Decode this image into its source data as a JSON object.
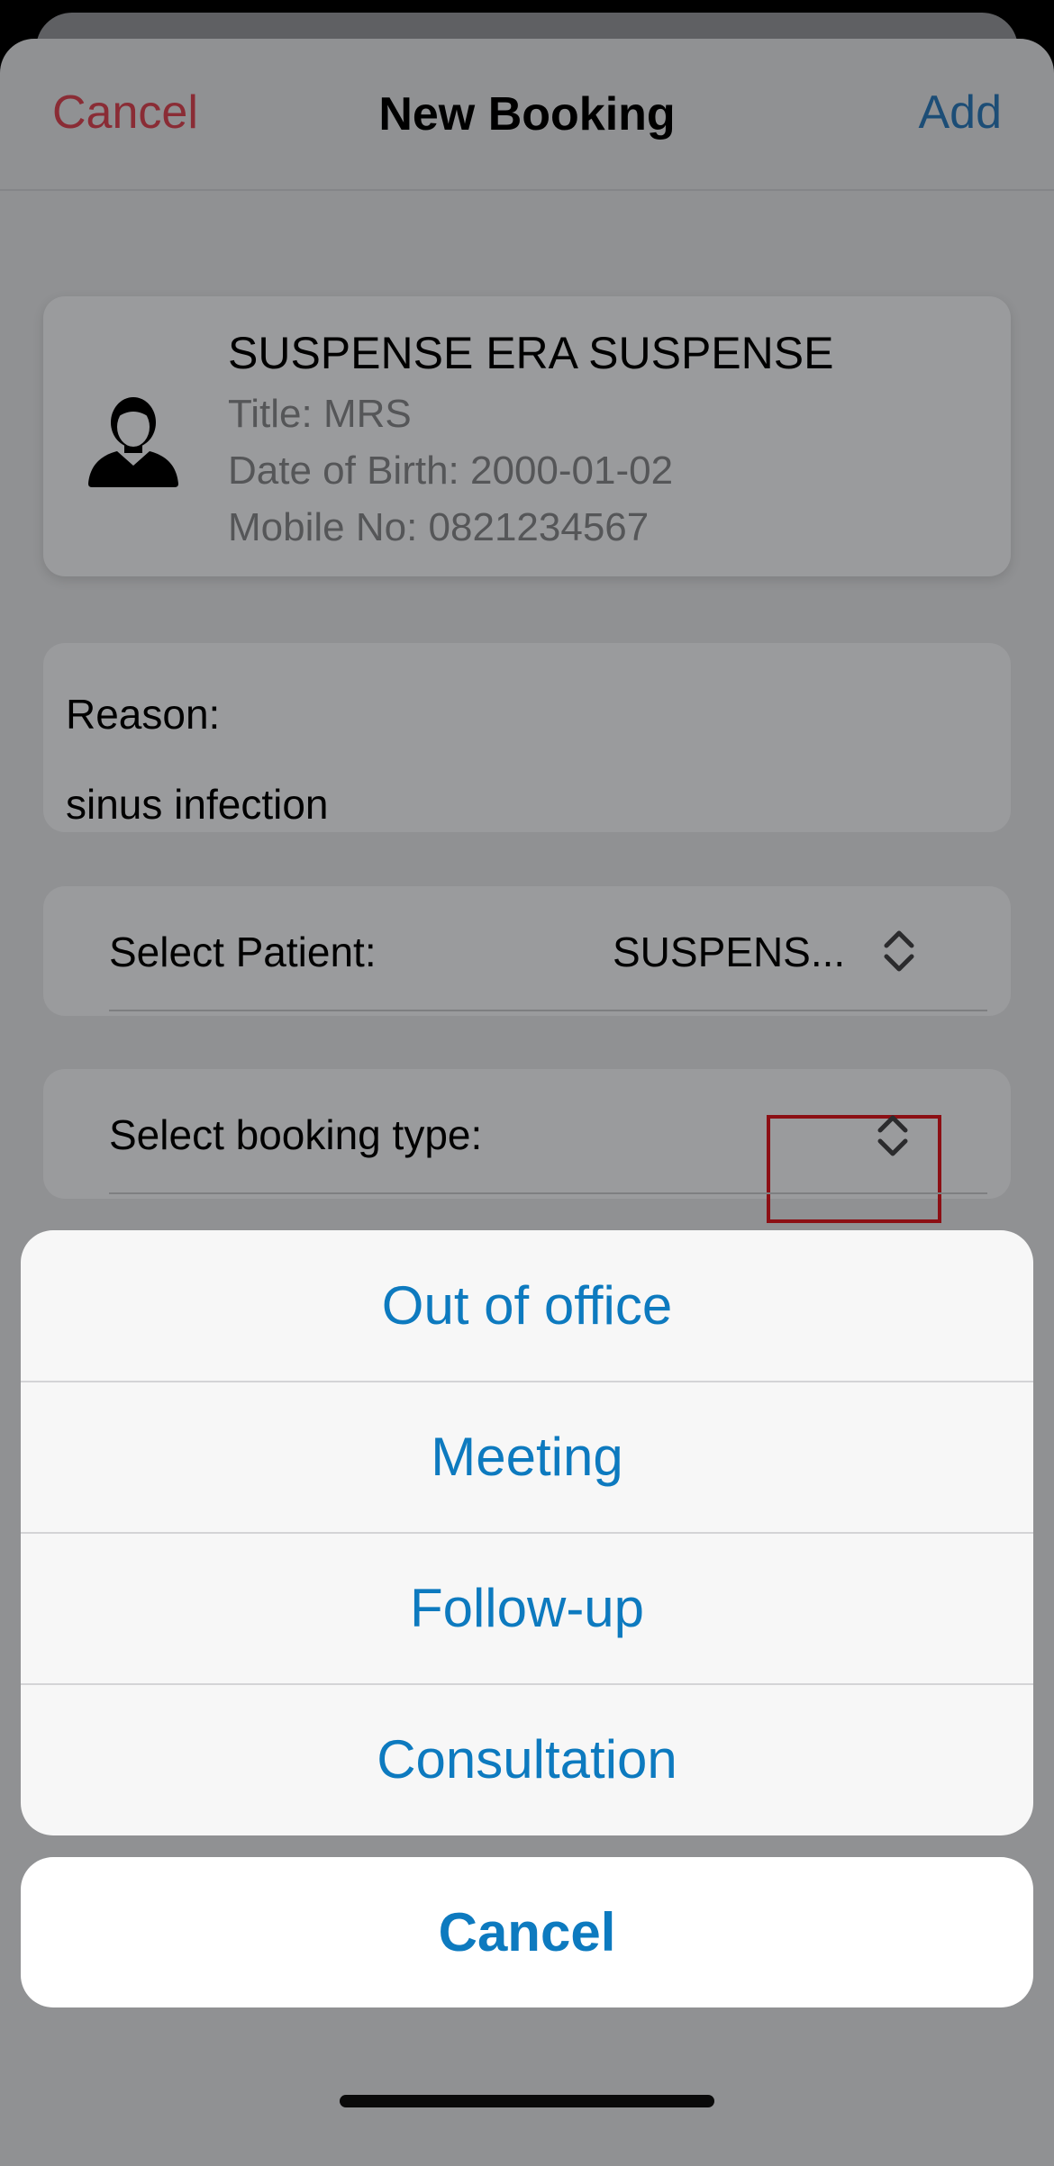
{
  "nav": {
    "cancel_label": "Cancel",
    "title": "New Booking",
    "add_label": "Add"
  },
  "patient": {
    "name": "SUSPENSE ERA SUSPENSE",
    "title_line": "Title: MRS",
    "dob_line": "Date of Birth: 2000-01-02",
    "mobile_line": "Mobile No: 0821234567",
    "avatar_icon": "person-avatar-icon"
  },
  "reason": {
    "label": "Reason:",
    "value": "sinus infection"
  },
  "select_patient": {
    "label": "Select Patient:",
    "value": "SUSPENS..."
  },
  "select_booking_type": {
    "label": "Select booking type:",
    "value": ""
  },
  "action_sheet": {
    "options": [
      {
        "label": "Out of office"
      },
      {
        "label": "Meeting"
      },
      {
        "label": "Follow-up"
      },
      {
        "label": "Consultation"
      }
    ],
    "cancel_label": "Cancel"
  },
  "colors": {
    "destructive_red": "#8a2c35",
    "nav_blue": "#1c4d76",
    "action_blue": "#0d7abf",
    "highlight_red": "#8c0f14"
  }
}
